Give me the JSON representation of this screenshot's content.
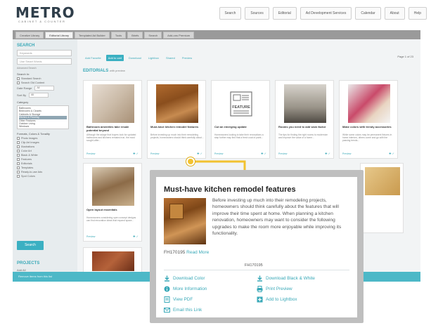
{
  "header": {
    "logo": "METRO",
    "logo_sub": "CABINET & COUNTER",
    "nav": [
      "Search",
      "Sources",
      "Editorial",
      "Ad Development Services",
      "Calendar",
      "About",
      "Help"
    ]
  },
  "tabs": [
    "Creative Library",
    "Editorial Library",
    "Templated Ad Builder",
    "Tools",
    "Briefs",
    "Search",
    "Add-ons Premium"
  ],
  "sidebar": {
    "search_title": "SEARCH",
    "input1": "Keywords",
    "input2": "Use Smart Words",
    "advanced": "Advanced Search",
    "search_in": "Search In:",
    "opt1": "Standard Search",
    "opt2": "Search Old Content",
    "date_label": "Date Range",
    "date_value": "All",
    "sort_label": "Sort By",
    "sort_value": "All",
    "cat_label": "Category",
    "categories": [
      "Bathrooms",
      "Bedrooms & Closets",
      "Cabinets & Storage",
      "Kitchen & Flooring",
      "Other Features",
      "Outdoor Living",
      "Windows"
    ],
    "types_label": "Formats, Colors & Tonality",
    "types": [
      "Photo Images",
      "Clip Art Images",
      "Illustrations",
      "Color Art",
      "Black & White",
      "Features",
      "Editorials",
      "Templates",
      "Ready-to-use Ads",
      "Spot Colors"
    ],
    "search_button": "Search",
    "projects_title": "PROJECTS",
    "projects_sub": "Add All"
  },
  "toolbar": [
    "Add Favorite",
    "Add to cart",
    "Download",
    "Lightbox",
    "Shared",
    "Preview"
  ],
  "pager": "Page 1 of 23",
  "section": {
    "title": "EDITORIALS",
    "sub": "with preview"
  },
  "cards": [
    {
      "title": "Bathroom amenities take resale potential beyond",
      "desc": "Although the adage that buyers look for updated bathrooms and kitchens remains true, the most sought-after...",
      "foot": "Preview"
    },
    {
      "title": "Must-have kitchen remodel features",
      "desc": "Before investing up much into their remodeling projects, homeowners should think carefully about...",
      "foot": "Preview"
    },
    {
      "title": "Cut an emerging update",
      "desc": "Homeowners looking to take their renovations a step further may find that a fresh coat of paint...",
      "foot": "Preview"
    },
    {
      "title": "Rooms you need to add wow factor",
      "desc": "The tips for finding the right rooms to modernize and improve the value of a home...",
      "foot": "Preview"
    },
    {
      "title": "Make colors with trendy accessories",
      "desc": "While some colors may be permanent fixtures in home interiors, others come and go with the passing trends...",
      "foot": "Preview"
    },
    {
      "title": "Open layout essentials",
      "desc": "Homeowners considering open concept designs can find renovation ideas that expand space...",
      "foot": "Preview"
    }
  ],
  "bluebar": "Remove items from this list",
  "popup": {
    "title": "Must-have kitchen remodel features",
    "body": "Before investing up much into their remodeling projects, homeowners should think carefully about the features that will improve their time spent at home. When planning a kitchen renovation, homeowners may want to consider the following upgrades to make the room more enjoyable while improving its functionality.",
    "id": "FH170195",
    "read_more": "Read More",
    "id2": "FH170195",
    "actions": {
      "download_color": "Download Color",
      "download_bw": "Download Black & White",
      "more_info": "More Information",
      "print_preview": "Print Preview",
      "view_pdf": "View PDF",
      "add_lightbox": "Add to Lightbox",
      "email_link": "Email this Link"
    }
  },
  "colors": {
    "accent": "#3bb0c2",
    "callout": "#f2c230",
    "frame": "#bfbfbf"
  }
}
